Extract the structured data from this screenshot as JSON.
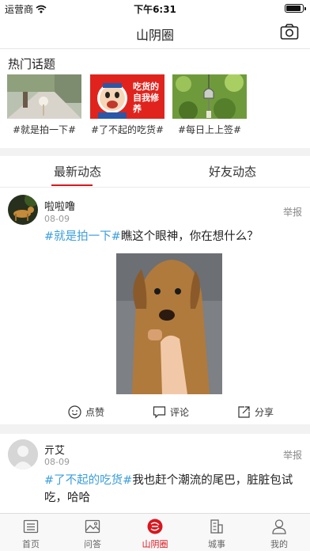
{
  "status_bar": {
    "carrier": "运营商",
    "time": "下午6:31",
    "battery_level": 0.9
  },
  "nav": {
    "title": "山阴圈",
    "camera_icon": "camera-icon"
  },
  "hot_topics": {
    "title": "热门话题",
    "items": [
      {
        "label": "#就是拍一下#"
      },
      {
        "label": "#了不起的吃货#",
        "image_text": "吃货的自我修养"
      },
      {
        "label": "#每日上上签#"
      }
    ]
  },
  "tabs": [
    {
      "label": "最新动态",
      "active": true
    },
    {
      "label": "好友动态",
      "active": false
    }
  ],
  "posts": [
    {
      "user": "啦啦噜",
      "date": "08-09",
      "report": "举报",
      "tag": "#就是拍一下#",
      "text": "瞧这个眼神，你在想什么？",
      "actions": {
        "like": "点赞",
        "comment": "评论",
        "share": "分享"
      }
    },
    {
      "user": "亓艾",
      "date": "08-09",
      "report": "举报",
      "tag": "#了不起的吃货#",
      "text": "我也赶个潮流的尾巴，脏脏包试吃，哈哈"
    }
  ],
  "tab_bar": [
    {
      "label": "首页",
      "icon": "home-icon"
    },
    {
      "label": "问答",
      "icon": "image-icon"
    },
    {
      "label": "山阴圈",
      "icon": "circle-logo-icon",
      "active": true
    },
    {
      "label": "城事",
      "icon": "building-icon"
    },
    {
      "label": "我的",
      "icon": "person-icon"
    }
  ],
  "colors": {
    "accent": "#d9161e",
    "tag": "#3b9fdc"
  }
}
